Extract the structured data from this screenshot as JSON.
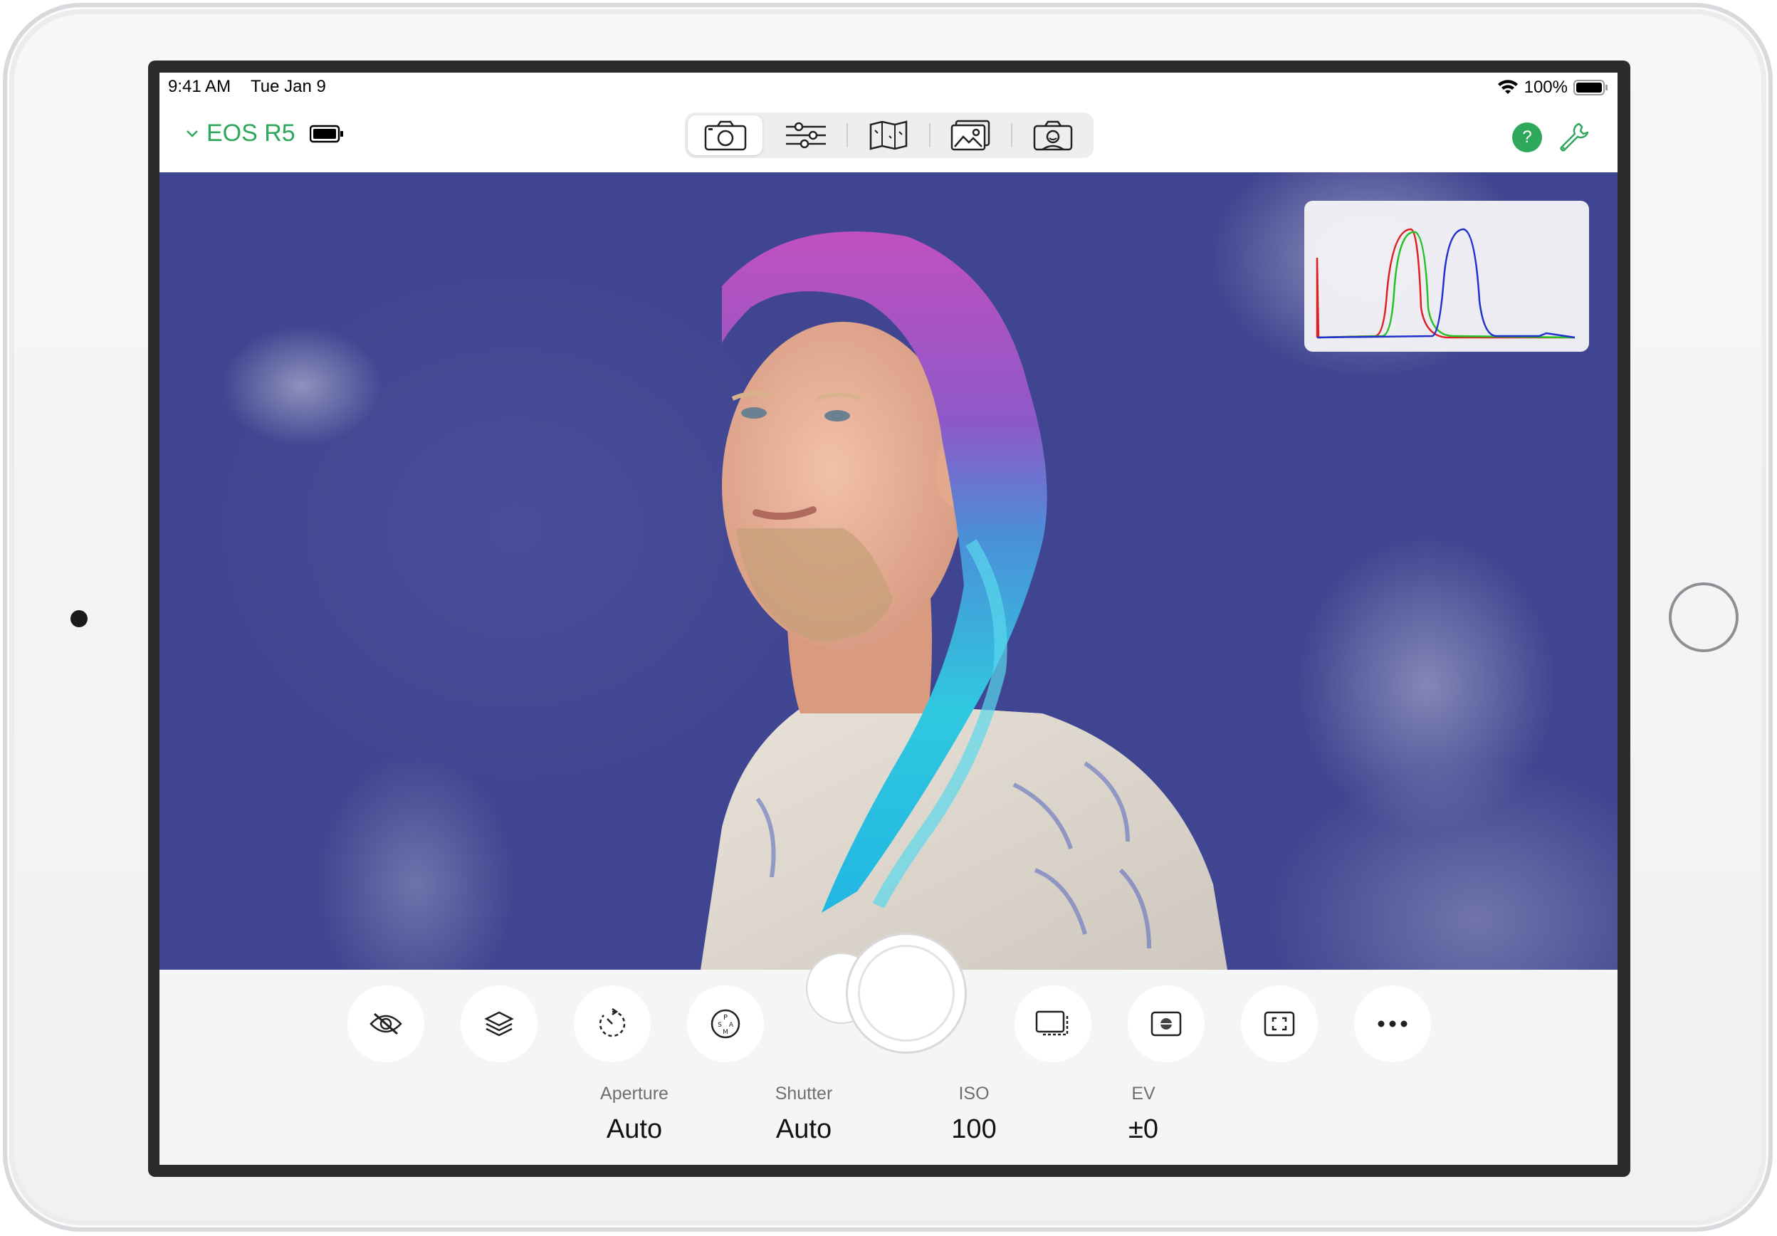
{
  "status_bar": {
    "time": "9:41 AM",
    "date": "Tue Jan 9",
    "battery": "100%"
  },
  "nav": {
    "camera_name": "EOS R5",
    "help_label": "?",
    "tabs": [
      {
        "name": "camera",
        "icon": "camera-icon",
        "active": true
      },
      {
        "name": "adjustments",
        "icon": "sliders-icon",
        "active": false
      },
      {
        "name": "map",
        "icon": "map-icon",
        "active": false
      },
      {
        "name": "gallery",
        "icon": "photos-icon",
        "active": false
      },
      {
        "name": "photobooth",
        "icon": "selfie-camera-icon",
        "active": false
      }
    ]
  },
  "controls": {
    "buttons": [
      {
        "name": "hide-overlay",
        "icon": "eye-slash-icon"
      },
      {
        "name": "layers",
        "icon": "layers-icon"
      },
      {
        "name": "timer",
        "icon": "timer-icon"
      },
      {
        "name": "mode",
        "icon": "mode-dial-icon"
      },
      {
        "name": "drive",
        "icon": "drive-mode-icon"
      },
      {
        "name": "metering",
        "icon": "metering-icon"
      },
      {
        "name": "focus",
        "icon": "focus-frame-icon"
      },
      {
        "name": "more",
        "icon": "more-icon"
      }
    ],
    "params": [
      {
        "label": "Aperture",
        "value": "Auto"
      },
      {
        "label": "Shutter",
        "value": "Auto"
      },
      {
        "label": "ISO",
        "value": "100"
      },
      {
        "label": "EV",
        "value": "±0"
      }
    ]
  },
  "colors": {
    "accent": "#2fa85c",
    "histogram_red": "#e02020",
    "histogram_green": "#28c028",
    "histogram_blue": "#2030d0"
  }
}
